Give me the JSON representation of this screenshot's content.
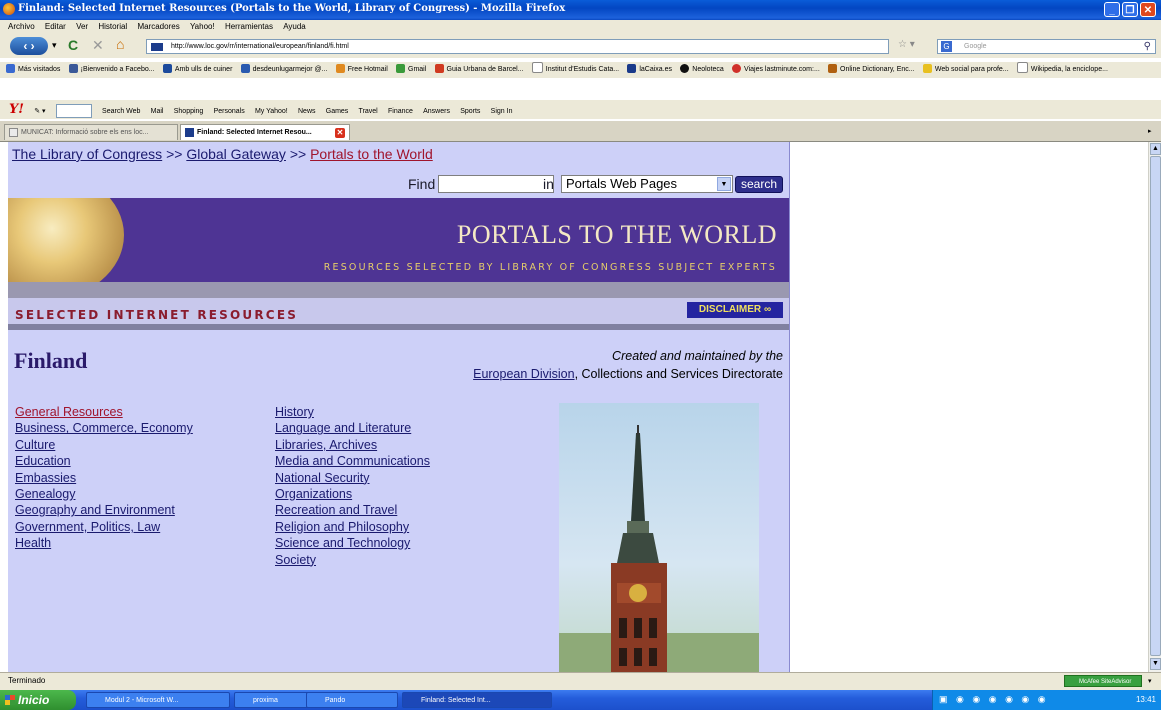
{
  "window": {
    "title": "Finland: Selected Internet Resources (Portals to the World, Library of Congress) - Mozilla Firefox"
  },
  "menu": [
    "Archivo",
    "Editar",
    "Ver",
    "Historial",
    "Marcadores",
    "Yahoo!",
    "Herramientas",
    "Ayuda"
  ],
  "nav": {
    "url": "http://www.loc.gov/rr/international/european/finland/fi.html",
    "search_engine_placeholder": "Google"
  },
  "bookmarks": [
    "Más visitados",
    "¡Bienvenido a Facebo...",
    "Amb ulls de cuiner",
    "desdeunlugarmejor @...",
    "Free Hotmail",
    "Gmail",
    "Guia Urbana de Barcel...",
    "Institut d'Estudis Cata...",
    "laCaixa.es",
    "Neoloteca",
    "Viajes lastminute.com:...",
    "Online Dictionary, Enc...",
    "Web social para profe...",
    "Wikipedia, la enciclope..."
  ],
  "yahoo_toolbar": [
    "Search Web",
    "Mail",
    "Shopping",
    "Personals",
    "My Yahoo!",
    "News",
    "Games",
    "Travel",
    "Finance",
    "Answers",
    "Sports",
    "Sign In"
  ],
  "tabs": [
    {
      "label": "MUNICAT: Informació sobre els ens loc..."
    },
    {
      "label": "Finland: Selected Internet Resou..."
    }
  ],
  "page": {
    "breadcrumb": {
      "home": "The Library of Congress",
      "sep": ">>",
      "gateway": "Global Gateway",
      "current": "Portals to the World"
    },
    "find_label": "Find",
    "in_label": "in",
    "scope_option": "Portals Web Pages",
    "search_button": "search",
    "banner_title": "PORTALS TO THE WORLD",
    "banner_subtitle": "RESOURCES SELECTED BY LIBRARY OF CONGRESS SUBJECT EXPERTS",
    "section_title": "SELECTED INTERNET RESOURCES",
    "disclaimer": "DISCLAIMER",
    "country": "Finland",
    "maintained_by": "Created and maintained by the",
    "division": "European Division",
    "directorate": ", Collections and Services Directorate",
    "topics_col1": [
      "General Resources",
      "Business, Commerce, Economy",
      "Culture",
      "Education",
      "Embassies",
      "Genealogy",
      "Geography and Environment",
      "Government, Politics, Law",
      "Health"
    ],
    "topics_col2": [
      "History",
      "Language and Literature",
      "Libraries, Archives",
      "Media and Communications",
      "National Security",
      "Organizations",
      "Recreation and Travel",
      "Religion and Philosophy",
      "Science and Technology",
      "Society"
    ]
  },
  "status": {
    "text": "Terminado",
    "site_advisor": "McAfee SiteAdvisor"
  },
  "taskbar": {
    "start": "Inicio",
    "tasks": [
      "Modul 2 - Microsoft W...",
      "proxima",
      "Pando",
      "Finland: Selected Int..."
    ],
    "clock": "13:41"
  },
  "colors": {
    "panel_bg": "#cdd0f8",
    "banner_bg": "#4e3494",
    "link": "#1a1a6e",
    "visited_link": "#a0142c"
  }
}
